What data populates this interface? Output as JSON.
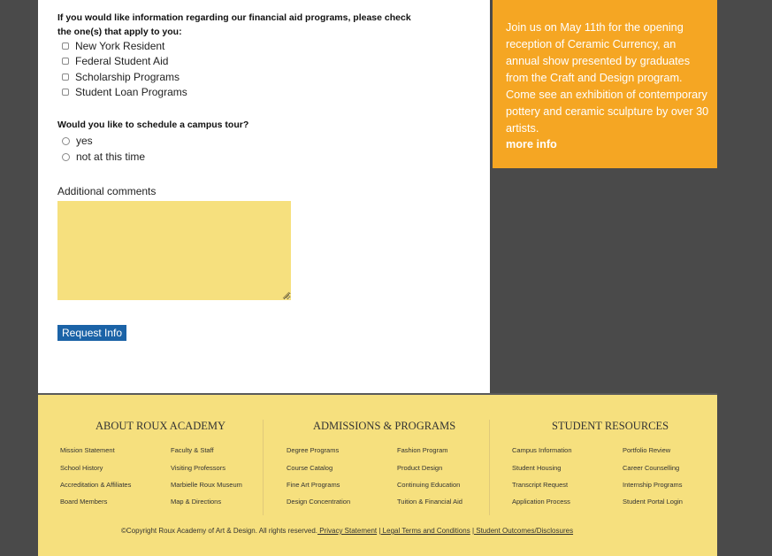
{
  "form": {
    "aid_question": "If you would like information regarding our financial aid programs, please check the one(s) that apply to you:",
    "aid_options": [
      "New York Resident",
      "Federal Student Aid",
      "Scholarship Programs",
      "Student Loan Programs"
    ],
    "tour_question": "Would you like to schedule a campus tour?",
    "tour_options": [
      "yes",
      "not at this time"
    ],
    "comments_label": "Additional comments",
    "comments_value": "",
    "submit_label": "Request Info"
  },
  "promo": {
    "text": "Join us on May 11th for the opening reception of Ceramic Currency, an annual show presented by graduates from the Craft and Design program. Come see an exhibition of contemporary pottery and ceramic sculpture by over 30 artists.",
    "more_link": "more info"
  },
  "footer": {
    "about": {
      "title": "ABOUT ROUX ACADEMY",
      "col1": [
        "Mission Statement",
        "School History",
        "Accreditation & Affiliates",
        "Board Members"
      ],
      "col2": [
        "Faculty & Staff",
        "Visiting Professors",
        "Marbielle Roux Museum",
        "Map & Directions"
      ]
    },
    "admissions": {
      "title": "ADMISSIONS & PROGRAMS",
      "col1": [
        "Degree Programs",
        "Course Catalog",
        "Fine Art Programs",
        "Design Concentration"
      ],
      "col2": [
        "Fashion Program",
        "Product Design",
        "Continuing Education",
        "Tuition & Financial Aid"
      ]
    },
    "resources": {
      "title": "STUDENT RESOURCES",
      "col1": [
        "Campus Information",
        "Student Housing",
        "Transcript Request",
        "Application Process"
      ],
      "col2": [
        "Portfolio Review",
        "Career Counselling",
        "Internship Programs",
        "Student Portal Login"
      ]
    },
    "copyright": "©Copyright Roux Academy of Art & Design. All rights reserved.",
    "legal_links": [
      " Privacy Statement",
      " Legal Terms and Conditions",
      " Student Outcomes/Disclosures"
    ],
    "separator": "|"
  }
}
